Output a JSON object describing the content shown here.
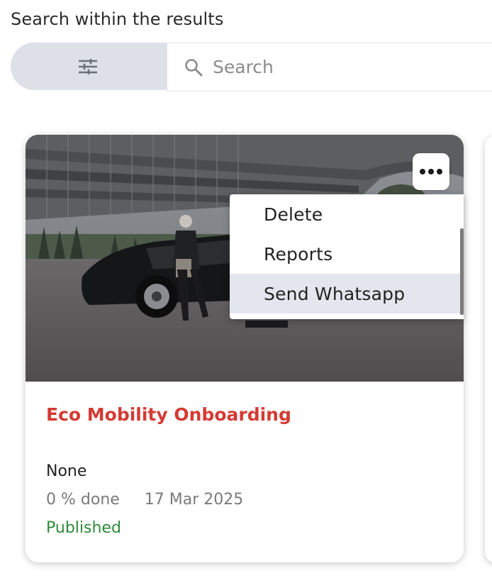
{
  "heading": "Search within the results",
  "filter_button": {
    "icon": "tune-sliders-icon"
  },
  "search": {
    "placeholder": "Search",
    "value": "",
    "icon": "search-icon"
  },
  "card": {
    "title": "Eco Mobility Onboarding",
    "category": "None",
    "progress_text": "0 % done",
    "progress": 0,
    "date": "17 Mar 2025",
    "status": "Published",
    "more_icon": "more-horizontal-icon"
  },
  "menu": {
    "items": [
      {
        "label": "Delete"
      },
      {
        "label": "Reports"
      },
      {
        "label": "Send Whatsapp"
      }
    ],
    "highlighted_index": 2
  },
  "colors": {
    "title": "#d33b33",
    "status": "#2f8a3b",
    "filter_bg": "#dde0e7",
    "menu_highlight": "#e3e6ec"
  }
}
